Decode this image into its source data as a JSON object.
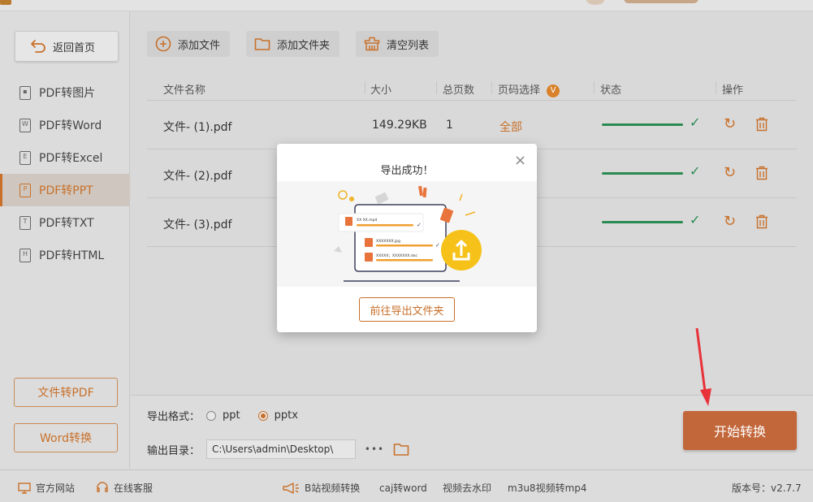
{
  "sidebar": {
    "back_label": "返回首页",
    "items": [
      {
        "label": "PDF转图片",
        "icon": "image-file-icon"
      },
      {
        "label": "PDF转Word",
        "icon": "word-file-icon"
      },
      {
        "label": "PDF转Excel",
        "icon": "excel-file-icon"
      },
      {
        "label": "PDF转PPT",
        "icon": "ppt-file-icon",
        "active": true
      },
      {
        "label": "PDF转TXT",
        "icon": "txt-file-icon"
      },
      {
        "label": "PDF转HTML",
        "icon": "html-file-icon"
      }
    ],
    "file_to_pdf": "文件转PDF",
    "word_convert": "Word转换"
  },
  "toolbar": {
    "add_file": "添加文件",
    "add_folder": "添加文件夹",
    "clear_list": "清空列表"
  },
  "table": {
    "headers": {
      "name": "文件名称",
      "size": "大小",
      "pages": "总页数",
      "page_select": "页码选择",
      "page_select_badge": "V",
      "status": "状态",
      "actions": "操作"
    },
    "rows": [
      {
        "name": "文件- (1).pdf",
        "size": "149.29KB",
        "pages": "1",
        "page_select": "全部",
        "progress": 1.0
      },
      {
        "name": "文件- (2).pdf",
        "size": "",
        "pages": "",
        "page_select": "",
        "progress": 1.0
      },
      {
        "name": "文件- (3).pdf",
        "size": "",
        "pages": "",
        "page_select": "",
        "progress": 1.0
      }
    ]
  },
  "bottom": {
    "format_label": "导出格式：",
    "format_options": [
      "ppt",
      "pptx"
    ],
    "format_selected": "pptx",
    "output_label": "输出目录：",
    "output_path": "C:\\Users\\admin\\Desktop\\",
    "more": "•••",
    "start_button": "开始转换"
  },
  "statusbar": {
    "website": "官方网站",
    "support": "在线客服",
    "bilibili": "B站视频转换",
    "caj": "caj转word",
    "watermark": "视频去水印",
    "m3u8": "m3u8视频转mp4",
    "version": "版本号：v2.7.7"
  },
  "modal": {
    "title": "导出成功！",
    "goto_button": "前往导出文件夹",
    "illustration": {
      "file1": "XX XX.mp4",
      "file2": "XXXXXXX.jpg",
      "file3": "XXXXX；XXXXXXX.doc"
    }
  },
  "colors": {
    "accent": "#c8702a",
    "start_button": "#c2673a",
    "success": "#2b8a52",
    "annotation_arrow": "#e8323a"
  }
}
